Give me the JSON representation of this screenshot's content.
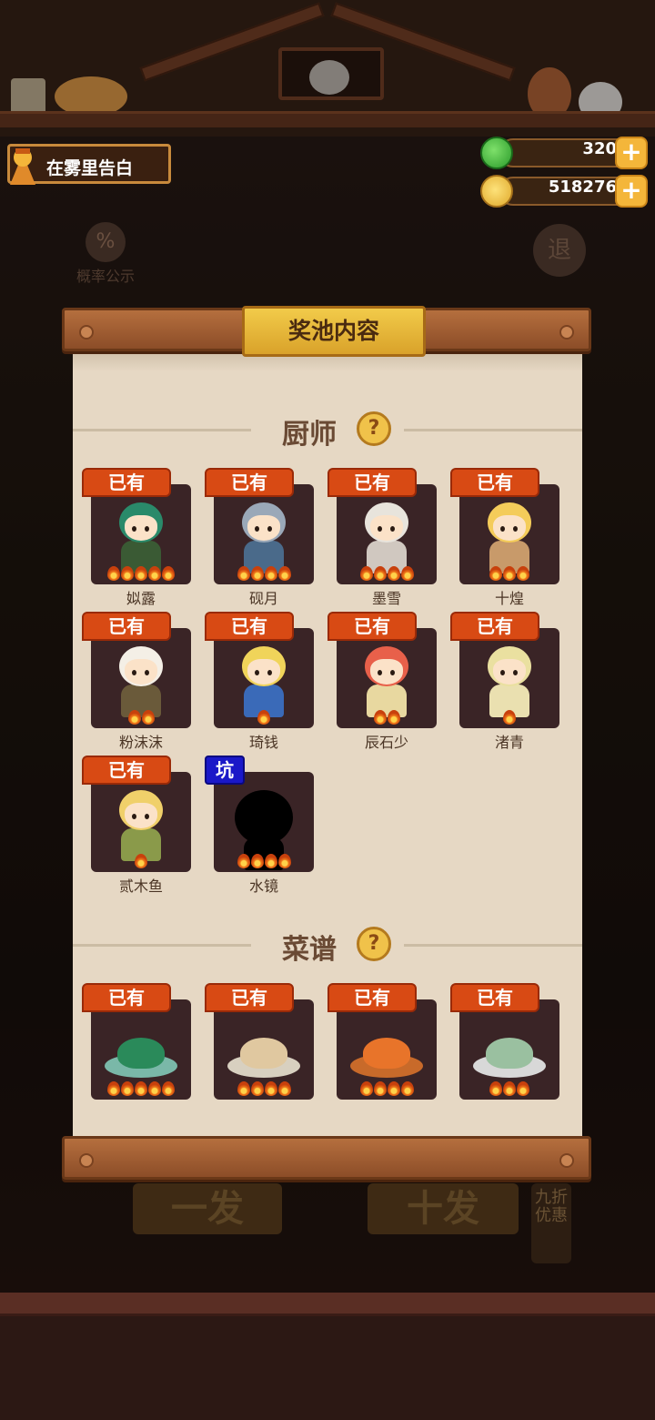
{
  "header": {
    "player_name": "在雾里告白",
    "currencies": [
      {
        "icon": "jade-icon",
        "value": "320"
      },
      {
        "icon": "coin-icon",
        "value": "518276"
      }
    ]
  },
  "background": {
    "probability_label": "概率公示",
    "probability_icon_text": "%",
    "exit_label": "退",
    "single_draw_label": "一发",
    "ten_draw_label": "十发",
    "discount_label": "九折优惠"
  },
  "panel": {
    "title": "奖池内容",
    "help_symbol": "?",
    "sections": [
      {
        "label": "厨师",
        "items": [
          {
            "name": "姒露",
            "tag": "已有",
            "flames": 5
          },
          {
            "name": "砚月",
            "tag": "已有",
            "flames": 4
          },
          {
            "name": "墨雪",
            "tag": "已有",
            "flames": 4
          },
          {
            "name": "十煌",
            "tag": "已有",
            "flames": 3
          },
          {
            "name": "粉沫沫",
            "tag": "已有",
            "flames": 2
          },
          {
            "name": "琦钱",
            "tag": "已有",
            "flames": 1
          },
          {
            "name": "辰石少",
            "tag": "已有",
            "flames": 2
          },
          {
            "name": "渚青",
            "tag": "已有",
            "flames": 1
          },
          {
            "name": "贰木鱼",
            "tag": "已有",
            "flames": 1
          },
          {
            "name": "水镜",
            "tag": "坑",
            "flames": 4
          }
        ]
      },
      {
        "label": "菜谱",
        "items": [
          {
            "tag": "已有",
            "flames": 5
          },
          {
            "tag": "已有",
            "flames": 4
          },
          {
            "tag": "已有",
            "flames": 4
          },
          {
            "tag": "已有",
            "flames": 3
          }
        ]
      }
    ]
  },
  "colors": {
    "tag_owned": "#d84a14",
    "tag_pit": "#1a18c8",
    "accent_gold": "#f2cb4a"
  }
}
